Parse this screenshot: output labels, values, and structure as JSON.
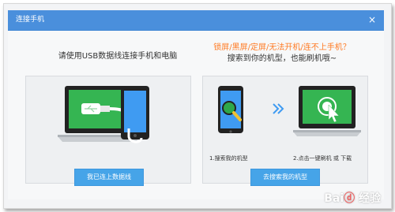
{
  "window": {
    "title": "连接手机",
    "close_glyph": "×"
  },
  "left_panel": {
    "heading": "请使用USB数据线连接手机和电脑",
    "button_label": "我已连上数据线",
    "illustration_icon": "laptop-usb-phone-icon"
  },
  "right_panel": {
    "warning": "锁屏/黑屏/定屏/无法开机/连不上手机？",
    "subheading": "搜索到你的机型，也能刷机哦~",
    "step1_caption": "1.搜索我的机型",
    "step2_caption": "2.点击一键刷机 或 下载",
    "button_label": "去搜索我的机型",
    "arrow_glyph": "»"
  },
  "watermark": {
    "text": "Bai 经验"
  },
  "colors": {
    "titlebar": "#4a8fdc",
    "button": "#46a4e8",
    "warning_text": "#ff7a23",
    "screen_green": "#35b552",
    "phone_screen_blue": "#3f9bf2"
  }
}
